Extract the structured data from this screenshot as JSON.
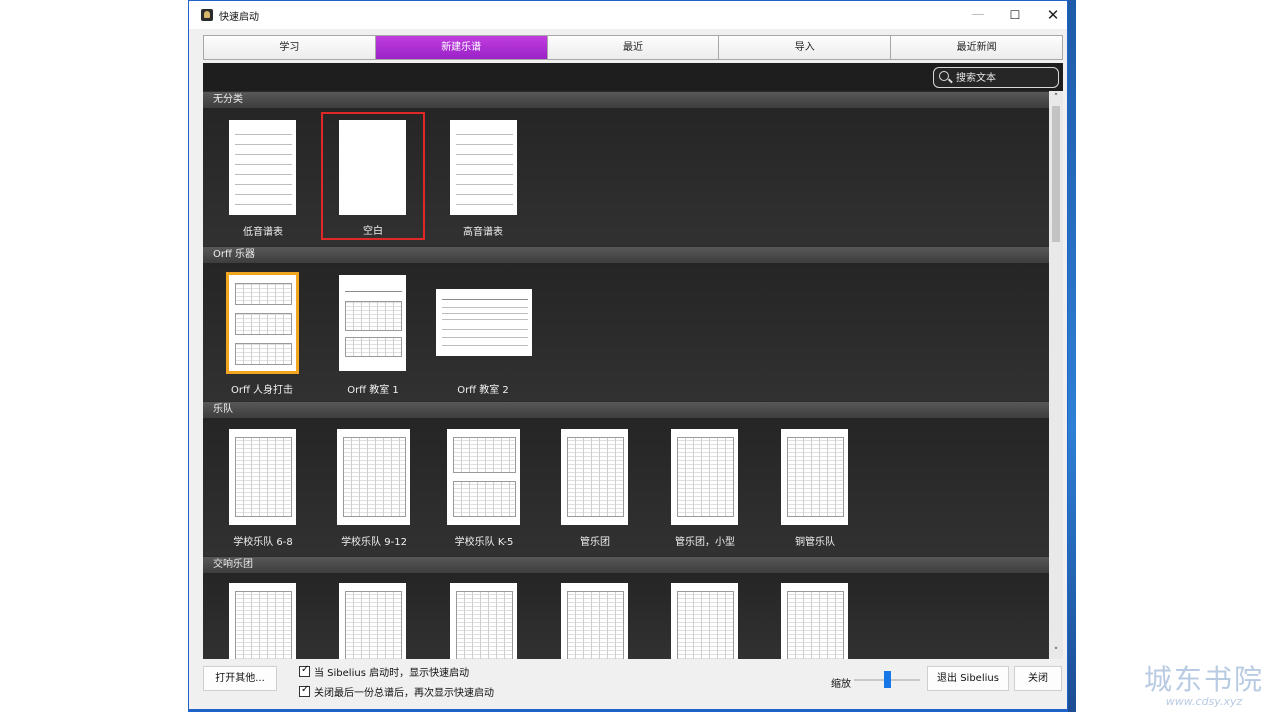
{
  "window": {
    "title": "快速启动",
    "min": "—",
    "max": "☐",
    "close": "✕"
  },
  "tabs": [
    {
      "label": "学习",
      "active": false
    },
    {
      "label": "新建乐谱",
      "active": true
    },
    {
      "label": "最近",
      "active": false
    },
    {
      "label": "导入",
      "active": false
    },
    {
      "label": "最近新闻",
      "active": false
    }
  ],
  "search": {
    "placeholder": "搜索文本"
  },
  "sections": [
    {
      "title": "无分类",
      "items": [
        "低音谱表",
        "空白",
        "高音谱表"
      ]
    },
    {
      "title": "Orff 乐器",
      "items": [
        "Orff 人身打击",
        "Orff 教室 1",
        "Orff 教室 2"
      ]
    },
    {
      "title": "乐队",
      "items": [
        "学校乐队 6-8",
        "学校乐队 9-12",
        "学校乐队 K-5",
        "管乐团",
        "管乐团，小型",
        "铜管乐队"
      ]
    },
    {
      "title": "交响乐团",
      "items": [
        "",
        "",
        "",
        "",
        "",
        ""
      ]
    }
  ],
  "footer": {
    "open_other": "打开其他...",
    "check1": "当 Sibelius 启动时，显示快速启动",
    "check2": "关闭最后一份总谱后，再次显示快速启动",
    "zoom_label": "缩放",
    "quit": "退出 Sibelius",
    "close": "关闭"
  },
  "scroll": {
    "up": "˄",
    "down": "˅"
  },
  "watermark": {
    "name": "城东书院",
    "url": "www.cdsy.xyz"
  },
  "colors": {
    "active_tab": "#a52bcf",
    "selected_red": "#e02828",
    "selected_orange": "#f2a521",
    "accent_blue": "#1877e6"
  }
}
